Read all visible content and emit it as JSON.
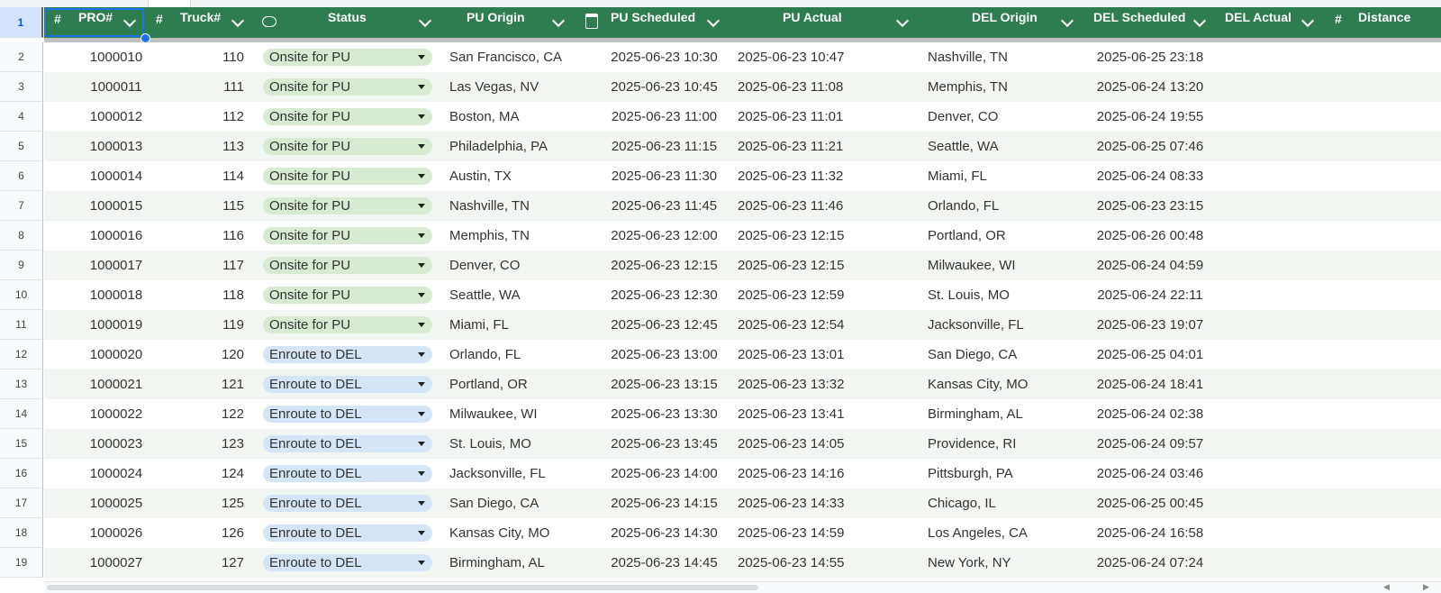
{
  "headers": {
    "pro": "PRO#",
    "truck": "Truck#",
    "status": "Status",
    "pu_origin": "PU Origin",
    "pu_scheduled": "PU Scheduled",
    "pu_actual": "PU Actual",
    "del_origin": "DEL Origin",
    "del_scheduled": "DEL Scheduled",
    "del_actual": "DEL Actual",
    "distance": "Distance",
    "number_symbol": "#"
  },
  "header_row_number": "1",
  "colors": {
    "header_bg": "#2e7d4f",
    "onsite_chip": "#d9ead3",
    "enroute_chip": "#d4e5f7",
    "selection": "#1a73e8"
  },
  "rows": [
    {
      "num": "2",
      "pro": "1000010",
      "truck": "110",
      "status": "Onsite for PU",
      "pu_origin": "San Francisco, CA",
      "pu_scheduled": "2025-06-23 10:30",
      "pu_actual": "2025-06-23 10:47",
      "del_origin": "Nashville, TN",
      "del_scheduled": "2025-06-25 23:18"
    },
    {
      "num": "3",
      "pro": "1000011",
      "truck": "111",
      "status": "Onsite for PU",
      "pu_origin": "Las Vegas, NV",
      "pu_scheduled": "2025-06-23 10:45",
      "pu_actual": "2025-06-23 11:08",
      "del_origin": "Memphis, TN",
      "del_scheduled": "2025-06-24 13:20"
    },
    {
      "num": "4",
      "pro": "1000012",
      "truck": "112",
      "status": "Onsite for PU",
      "pu_origin": "Boston, MA",
      "pu_scheduled": "2025-06-23 11:00",
      "pu_actual": "2025-06-23 11:01",
      "del_origin": "Denver, CO",
      "del_scheduled": "2025-06-24 19:55"
    },
    {
      "num": "5",
      "pro": "1000013",
      "truck": "113",
      "status": "Onsite for PU",
      "pu_origin": "Philadelphia, PA",
      "pu_scheduled": "2025-06-23 11:15",
      "pu_actual": "2025-06-23 11:21",
      "del_origin": "Seattle, WA",
      "del_scheduled": "2025-06-25 07:46"
    },
    {
      "num": "6",
      "pro": "1000014",
      "truck": "114",
      "status": "Onsite for PU",
      "pu_origin": "Austin, TX",
      "pu_scheduled": "2025-06-23 11:30",
      "pu_actual": "2025-06-23 11:32",
      "del_origin": "Miami, FL",
      "del_scheduled": "2025-06-24 08:33"
    },
    {
      "num": "7",
      "pro": "1000015",
      "truck": "115",
      "status": "Onsite for PU",
      "pu_origin": "Nashville, TN",
      "pu_scheduled": "2025-06-23 11:45",
      "pu_actual": "2025-06-23 11:46",
      "del_origin": "Orlando, FL",
      "del_scheduled": "2025-06-23 23:15"
    },
    {
      "num": "8",
      "pro": "1000016",
      "truck": "116",
      "status": "Onsite for PU",
      "pu_origin": "Memphis, TN",
      "pu_scheduled": "2025-06-23 12:00",
      "pu_actual": "2025-06-23 12:15",
      "del_origin": "Portland, OR",
      "del_scheduled": "2025-06-26 00:48"
    },
    {
      "num": "9",
      "pro": "1000017",
      "truck": "117",
      "status": "Onsite for PU",
      "pu_origin": "Denver, CO",
      "pu_scheduled": "2025-06-23 12:15",
      "pu_actual": "2025-06-23 12:15",
      "del_origin": "Milwaukee, WI",
      "del_scheduled": "2025-06-24 04:59"
    },
    {
      "num": "10",
      "pro": "1000018",
      "truck": "118",
      "status": "Onsite for PU",
      "pu_origin": "Seattle, WA",
      "pu_scheduled": "2025-06-23 12:30",
      "pu_actual": "2025-06-23 12:59",
      "del_origin": "St. Louis, MO",
      "del_scheduled": "2025-06-24 22:11"
    },
    {
      "num": "11",
      "pro": "1000019",
      "truck": "119",
      "status": "Onsite for PU",
      "pu_origin": "Miami, FL",
      "pu_scheduled": "2025-06-23 12:45",
      "pu_actual": "2025-06-23 12:54",
      "del_origin": "Jacksonville, FL",
      "del_scheduled": "2025-06-23 19:07"
    },
    {
      "num": "12",
      "pro": "1000020",
      "truck": "120",
      "status": "Enroute to DEL",
      "pu_origin": "Orlando, FL",
      "pu_scheduled": "2025-06-23 13:00",
      "pu_actual": "2025-06-23 13:01",
      "del_origin": "San Diego, CA",
      "del_scheduled": "2025-06-25 04:01"
    },
    {
      "num": "13",
      "pro": "1000021",
      "truck": "121",
      "status": "Enroute to DEL",
      "pu_origin": "Portland, OR",
      "pu_scheduled": "2025-06-23 13:15",
      "pu_actual": "2025-06-23 13:32",
      "del_origin": "Kansas City, MO",
      "del_scheduled": "2025-06-24 18:41"
    },
    {
      "num": "14",
      "pro": "1000022",
      "truck": "122",
      "status": "Enroute to DEL",
      "pu_origin": "Milwaukee, WI",
      "pu_scheduled": "2025-06-23 13:30",
      "pu_actual": "2025-06-23 13:41",
      "del_origin": "Birmingham, AL",
      "del_scheduled": "2025-06-24 02:38"
    },
    {
      "num": "15",
      "pro": "1000023",
      "truck": "123",
      "status": "Enroute to DEL",
      "pu_origin": "St. Louis, MO",
      "pu_scheduled": "2025-06-23 13:45",
      "pu_actual": "2025-06-23 14:05",
      "del_origin": "Providence, RI",
      "del_scheduled": "2025-06-24 09:57"
    },
    {
      "num": "16",
      "pro": "1000024",
      "truck": "124",
      "status": "Enroute to DEL",
      "pu_origin": "Jacksonville, FL",
      "pu_scheduled": "2025-06-23 14:00",
      "pu_actual": "2025-06-23 14:16",
      "del_origin": "Pittsburgh, PA",
      "del_scheduled": "2025-06-24 03:46"
    },
    {
      "num": "17",
      "pro": "1000025",
      "truck": "125",
      "status": "Enroute to DEL",
      "pu_origin": "San Diego, CA",
      "pu_scheduled": "2025-06-23 14:15",
      "pu_actual": "2025-06-23 14:33",
      "del_origin": "Chicago, IL",
      "del_scheduled": "2025-06-25 00:45"
    },
    {
      "num": "18",
      "pro": "1000026",
      "truck": "126",
      "status": "Enroute to DEL",
      "pu_origin": "Kansas City, MO",
      "pu_scheduled": "2025-06-23 14:30",
      "pu_actual": "2025-06-23 14:59",
      "del_origin": "Los Angeles, CA",
      "del_scheduled": "2025-06-24 16:58"
    },
    {
      "num": "19",
      "pro": "1000027",
      "truck": "127",
      "status": "Enroute to DEL",
      "pu_origin": "Birmingham, AL",
      "pu_scheduled": "2025-06-23 14:45",
      "pu_actual": "2025-06-23 14:55",
      "del_origin": "New York, NY",
      "del_scheduled": "2025-06-24 07:24"
    }
  ]
}
